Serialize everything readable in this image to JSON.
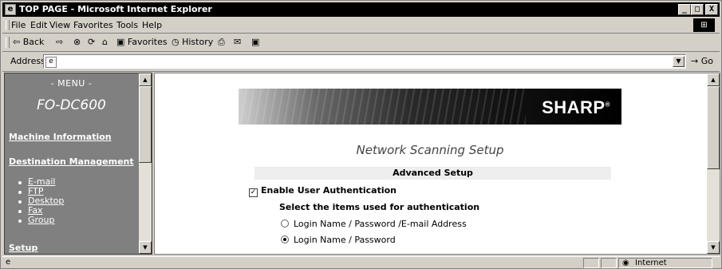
{
  "window": {
    "title": "TOP PAGE - Microsoft Internet Explorer",
    "minimize": "_",
    "maximize": "□",
    "close": "X"
  },
  "menubar": {
    "items": [
      "File",
      "Edit",
      "View",
      "Favorites",
      "Tools",
      "Help"
    ]
  },
  "toolbar": {
    "back": "⇦ Back",
    "forward": "⇨",
    "stop": "⊗",
    "refresh": "⟳",
    "home": "⌂",
    "favorites": "Favorites",
    "history": "History",
    "mail": "✉",
    "edit": "▣"
  },
  "address": {
    "label": "Address",
    "value": "",
    "go": "Go"
  },
  "left_nav": {
    "menu_heading": "- MENU -",
    "model": "FO-DC600",
    "machine_information": "Machine Information",
    "destination_management": "Destination Management",
    "sub_items": [
      "E-mail",
      "FTP",
      "Desktop",
      "Fax",
      "Group"
    ],
    "setup": "Setup"
  },
  "main": {
    "brand": "SHARP",
    "brand_mark": "®",
    "page_title": "Network Scanning Setup",
    "section_header": "Advanced Setup",
    "enable_auth_label": "Enable User Authentication",
    "enable_auth_checked": true,
    "select_items_label": "Select the items used for authentication",
    "options": [
      {
        "label": "Login Name / Password /E-mail Address",
        "selected": false
      },
      {
        "label": "Login Name / Password",
        "selected": true
      }
    ]
  },
  "status": {
    "zone": "Internet"
  },
  "colors": {
    "nav_bg": "#808080",
    "chrome": "#d4d0c8",
    "section_bg": "#eeeeee"
  }
}
